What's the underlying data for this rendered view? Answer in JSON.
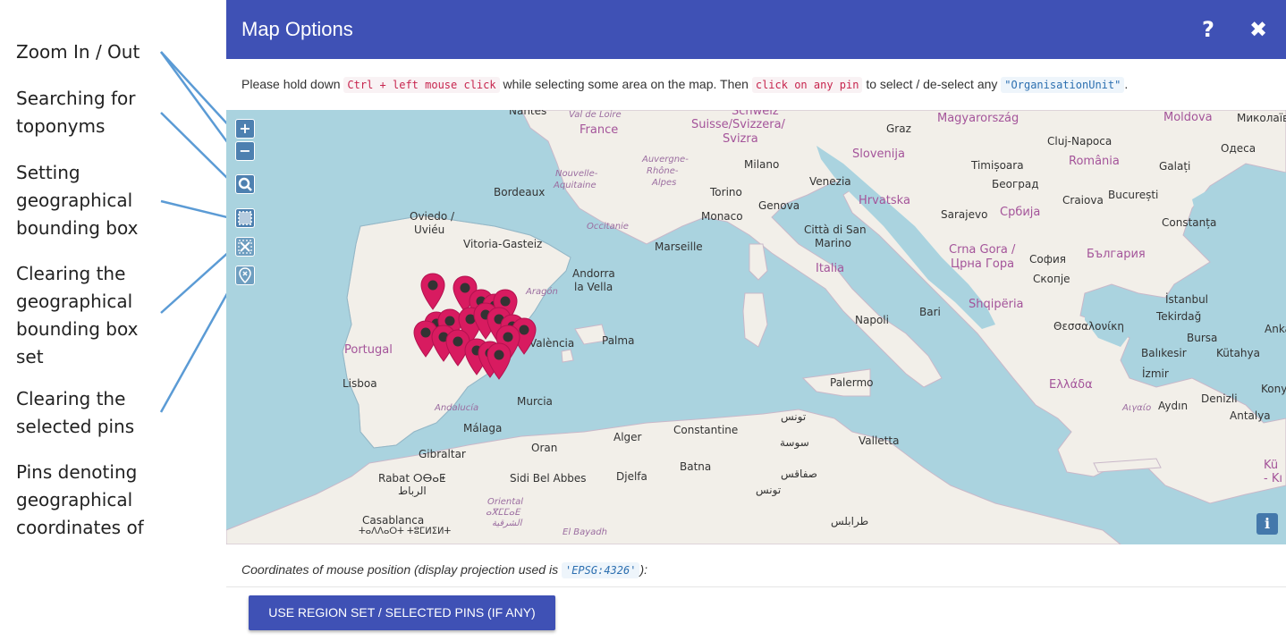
{
  "annotations": [
    "Zoom In / Out",
    "Searching for toponyms",
    "Setting geographical bounding box",
    "Clearing the geographical bounding box set",
    "Clearing the selected pins",
    "Pins denoting geographical coordinates of"
  ],
  "dialog": {
    "title": "Map Options",
    "help_icon": "?",
    "close_icon": "✖"
  },
  "instructions": {
    "part1": "Please hold down ",
    "code1": "Ctrl + left mouse click",
    "part2": " while selecting some area on the map. Then ",
    "code2": "click on any pin",
    "part3": " to select / de-select any ",
    "code3": "\"OrganisationUnit\"",
    "part4": "."
  },
  "map": {
    "controls": {
      "zoom_in": "+",
      "zoom_out": "−",
      "search_icon": "search-icon",
      "bbox_icon": "bounding-box-icon",
      "clear_bbox_icon": "clear-bbox-icon",
      "clear_pins_icon": "clear-pins-icon",
      "info": "i"
    },
    "colors": {
      "sea": "#aad3df",
      "land": "#f2efe9",
      "pin": "#d81b60"
    },
    "labels": {
      "nantes": "Nantes",
      "val_de_loire": "Val de Loire",
      "france": "France",
      "suisse": "Suisse/Svizzera/",
      "svizra": "Svizra",
      "schweiz": "Schweiz",
      "graz": "Graz",
      "magyarorszag": "Magyarország",
      "moldova": "Moldova",
      "mykolaiv": "Миколаїв",
      "cluj": "Cluj-Napoca",
      "odesa": "Одеса",
      "slovenija": "Slovenija",
      "romania": "România",
      "timisoara": "Timișoara",
      "galati": "Galați",
      "nouvelle": "Nouvelle-",
      "aquitaine": "Aquitaine",
      "auvergne": "Auvergne-",
      "rhone": "Rhône-",
      "alpes": "Alpes",
      "milano": "Milano",
      "venezia": "Venezia",
      "beograd": "Београд",
      "bordeaux": "Bordeaux",
      "torino": "Torino",
      "genova": "Genova",
      "hrvatska": "Hrvatska",
      "craiova": "Craiova",
      "bucuresti": "București",
      "oviedo": "Oviedo /",
      "uvieu": "Uviéu",
      "occitanie": "Occitanie",
      "monaco": "Monaco",
      "sarajevo": "Sarajevo",
      "srbija": "Србија",
      "constanta": "Constanța",
      "vitoria": "Vitoria-Gasteiz",
      "marseille": "Marseille",
      "citta": "Città di San",
      "marino": "Marino",
      "crna_gora": "Crna Gora /",
      "crna_gora_cyr": "Црна Гора",
      "sofia": "София",
      "bulgaria": "България",
      "andorra": "Andorra",
      "la_vella": "la Vella",
      "italia": "Italia",
      "skopje": "Скопје",
      "aragon": "Aragón",
      "istanbul": "İstanbul",
      "napoli": "Napoli",
      "bari": "Bari",
      "shqiperia": "Shqipëria",
      "thessaloniki": "Θεσσαλονίκη",
      "tekirdag": "Tekirdağ",
      "portugal": "Portugal",
      "valencia": "València",
      "palma": "Palma",
      "bursa": "Bursa",
      "ankara": "Anka",
      "balikesir": "Balıkesir",
      "kutahya": "Kütahya",
      "lisboa": "Lisboa",
      "izmir": "İzmir",
      "palermo": "Palermo",
      "ellada": "Ελλάδα",
      "konya": "Konya",
      "andalucia": "Andalucía",
      "murcia": "Murcia",
      "aigaio": "Αιγαίο",
      "aydin": "Aydın",
      "denizli": "Denizli",
      "antalya": "Antalya",
      "tunis": "تونس",
      "malaga": "Málaga",
      "alger": "Alger",
      "constantine": "Constantine",
      "sousse": "سوسة",
      "valletta": "Valletta",
      "oran": "Oran",
      "gibraltar": "Gibraltar",
      "batna": "Batna",
      "sfax": "صفاقس",
      "rabat": "Rabat ⵔⴱⴰⵟ",
      "rabat_ar": "الرباط",
      "sidi": "Sidi Bel Abbes",
      "djelfa": "Djelfa",
      "tunisia": "تونس",
      "ku": "Kü",
      "ki": "- Kı",
      "oriental": "Oriental",
      "oriental_tif": "ⴰⴳⵎⵎⴰⴹ",
      "oriental_ar": "الشرقية",
      "casablanca": "Casablanca",
      "casablanca_tif": "ⵜⴰⴷⴷⴰⵔⵜ ⵜⵓⵎⵍⵉⵍⵜ",
      "el_bayadh": "El Bayadh",
      "tripoli": "طرابلس"
    }
  },
  "footer": {
    "coords_text1": "Coordinates of mouse position (display projection used is ",
    "coords_code": "'EPSG:4326'",
    "coords_text2": "):",
    "use_button": "USE REGION SET / SELECTED PINS (IF ANY)"
  }
}
